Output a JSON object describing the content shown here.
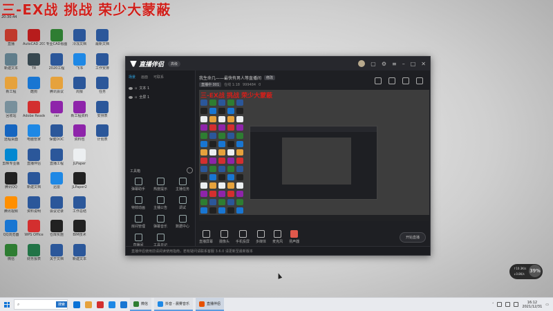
{
  "overlay": {
    "title": "三-EX战 挑战 荣少大蒙蔽",
    "subtitle": "20:30:44"
  },
  "desktop_icons": [
    {
      "label": "直播",
      "icon": "stream-icon",
      "color": "#c0392b"
    },
    {
      "label": "AutoCAD 2018",
      "icon": "autocad-icon",
      "color": "#b71c1c"
    },
    {
      "label": "专业CAD看图",
      "icon": "cad-viewer-icon",
      "color": "#2e7d32"
    },
    {
      "label": "冷冻文档",
      "icon": "word-doc-icon",
      "color": "#2b579a"
    },
    {
      "label": "最新文档",
      "icon": "word-doc-icon",
      "color": "#2b579a"
    },
    {
      "label": "新建文本",
      "icon": "text-file-icon",
      "color": "#607d8b"
    },
    {
      "label": "T8",
      "icon": "t8-icon",
      "color": "#37474f"
    },
    {
      "label": "2020工程",
      "icon": "word-doc-icon",
      "color": "#2b579a"
    },
    {
      "label": "飞书",
      "icon": "feishu-icon",
      "color": "#1e88e5"
    },
    {
      "label": "工作安排",
      "icon": "word-doc-icon",
      "color": "#2b579a"
    },
    {
      "label": "新工程",
      "icon": "folder-icon",
      "color": "#e6a23c"
    },
    {
      "label": "酷狗",
      "icon": "kugou-icon",
      "color": "#1976d2"
    },
    {
      "label": "腾讯会议",
      "icon": "folder-icon",
      "color": "#e6a23c"
    },
    {
      "label": "周报",
      "icon": "word-doc-icon",
      "color": "#2b579a"
    },
    {
      "label": "任务",
      "icon": "word-doc-icon",
      "color": "#2b579a"
    },
    {
      "label": "回收站",
      "icon": "recycle-bin-icon",
      "color": "#78909c"
    },
    {
      "label": "Adobe Reader XI",
      "icon": "pdf-icon",
      "color": "#d32f2f"
    },
    {
      "label": "rar",
      "icon": "archive-icon",
      "color": "#8e24aa"
    },
    {
      "label": "新工程资料",
      "icon": "archive-icon",
      "color": "#8e24aa"
    },
    {
      "label": "安排表",
      "icon": "word-doc-icon",
      "color": "#2b579a"
    },
    {
      "label": "远程桌面",
      "icon": "remote-desktop-icon",
      "color": "#1565c0"
    },
    {
      "label": "电脑管家",
      "icon": "shield-icon",
      "color": "#1e88e5"
    },
    {
      "label": "保健DOC",
      "icon": "word-doc-icon",
      "color": "#2b579a"
    },
    {
      "label": "资料包",
      "icon": "archive-icon",
      "color": "#8e24aa"
    },
    {
      "label": "计划表",
      "icon": "word-doc-icon",
      "color": "#2b579a"
    },
    {
      "label": "剪映专业版",
      "icon": "capcut-icon",
      "color": "#0288d1"
    },
    {
      "label": "直播伴侣",
      "icon": "stream-app-icon",
      "color": "#2b579a"
    },
    {
      "label": "直播工程",
      "icon": "word-doc-icon",
      "color": "#2b579a"
    },
    {
      "label": "JLPaper",
      "icon": "document-icon",
      "color": "#eceff1"
    },
    {
      "label": "",
      "icon": "blank-icon",
      "color": "transparent"
    },
    {
      "label": "腾讯QQ",
      "icon": "qq-icon",
      "color": "#212121"
    },
    {
      "label": "新建文档",
      "icon": "word-doc-icon",
      "color": "#2b579a"
    },
    {
      "label": "迅雷",
      "icon": "xunlei-icon",
      "color": "#1e88e5"
    },
    {
      "label": "JLPaper2",
      "icon": "document-icon",
      "color": "#212121"
    },
    {
      "label": "",
      "icon": "blank-icon",
      "color": "transparent"
    },
    {
      "label": "腾讯视频",
      "icon": "tencent-video-icon",
      "color": "#ff8f00"
    },
    {
      "label": "资料说明",
      "icon": "word-doc-icon",
      "color": "#2b579a"
    },
    {
      "label": "会议记录",
      "icon": "word-doc-icon",
      "color": "#2b579a"
    },
    {
      "label": "工作总结",
      "icon": "word-doc-icon",
      "color": "#2b579a"
    },
    {
      "label": "",
      "icon": "blank-icon",
      "color": "transparent"
    },
    {
      "label": "QQ浏览器",
      "icon": "qq-browser-icon",
      "color": "#1976d2"
    },
    {
      "label": "WPS Office",
      "icon": "wps-icon",
      "color": "#d32f2f"
    },
    {
      "label": "仓库实施",
      "icon": "screenshot-icon",
      "color": "#212121"
    },
    {
      "label": "BIM技术",
      "icon": "screenshot-icon",
      "color": "#212121"
    },
    {
      "label": "",
      "icon": "blank-icon",
      "color": "transparent"
    },
    {
      "label": "微信",
      "icon": "wechat-icon",
      "color": "#2e7d32"
    },
    {
      "label": "财务报表",
      "icon": "excel-icon",
      "color": "#217346"
    },
    {
      "label": "关于文档",
      "icon": "word-doc-icon",
      "color": "#2b579a"
    },
    {
      "label": "新建文本",
      "icon": "word-doc-icon",
      "color": "#2b579a"
    },
    {
      "label": "",
      "icon": "blank-icon",
      "color": "transparent"
    }
  ],
  "app": {
    "name": "直播伴侣",
    "tag": "高级",
    "tabs": [
      "场景",
      "画面",
      "可联系"
    ],
    "scenes": [
      "文本 1",
      "全屏 1"
    ],
    "tools_header": "工具箱",
    "tools": [
      "弹幕助手",
      "热度提示",
      "主播任务",
      "特效动画",
      "主播公告",
      "调试",
      "房间管理",
      "弹幕音乐",
      "数据中心",
      "直播间",
      "工具日记",
      ""
    ],
    "status_text": "直播伴侣使用前请阅读使用指南，若有疑问请联系客服 3.6.0 请更新至最新版本",
    "room": {
      "title": "我生命几——最快有男人等直播间",
      "pill": "修改",
      "meta_chip": "直播中 001",
      "viewers": "在线 1:18",
      "likes": "999484",
      "extra": "0"
    },
    "preview_red_text": "三-EX战 挑战 荣少大蒙蔽",
    "controls": [
      "直播屏幕",
      "摄像头",
      "手机投屏",
      "多媒体",
      "麦克风",
      "扬声器"
    ],
    "start_button": "开始直播",
    "net_badge": "网络正常"
  },
  "net_widget": {
    "up": "↑10.3K/s",
    "down": "↓0.8K/s",
    "percent": "39%"
  },
  "taskbar": {
    "search_placeholder": "搜索",
    "search_button": "搜索",
    "apps": [
      {
        "label": "微信",
        "color": "#2e7d32",
        "active": false
      },
      {
        "label": "抖音 - 晨雾音乐",
        "color": "#1e88e5",
        "active": false
      },
      {
        "label": "直播伴侣",
        "color": "#e65100",
        "active": true
      }
    ],
    "clock_time": "16:12",
    "clock_date": "2021/12/31"
  }
}
